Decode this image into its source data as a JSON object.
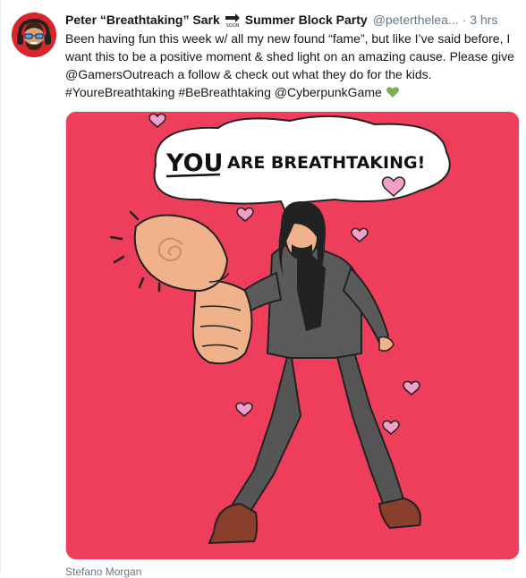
{
  "tweet": {
    "name": "Peter “Breathtaking” Sark",
    "emoji_name": "soon-arrow-icon",
    "name_suffix": "Summer Block Party",
    "handle": "@peterthelea...",
    "separator": "·",
    "time": "3 hrs",
    "line1": "Been having fun this week w/ all my new found “fame”, but like I’ve said before, I",
    "line2": "want this to be a positive moment & shed light on an amazing cause. Please give",
    "line3": "@GamersOutreach a follow & check out what they do for the kids.",
    "line4": "#YoureBreathtaking #BeBreathtaking @CyberpunkGame",
    "heart_icon": "green-heart-icon"
  },
  "media": {
    "bubble_text_you": "YOU",
    "bubble_text_rest": "ARE BREATHTAKING!",
    "background_color": "#ee3e5b"
  },
  "credit": "Stefano Morgan"
}
